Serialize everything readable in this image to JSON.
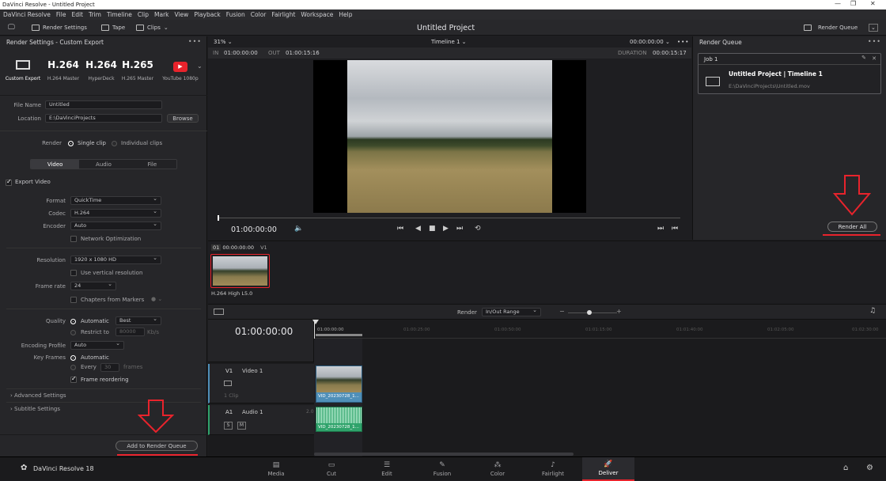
{
  "window": {
    "title": "DaVinci Resolve - Untitled Project"
  },
  "menu": [
    "DaVinci Resolve",
    "File",
    "Edit",
    "Trim",
    "Timeline",
    "Clip",
    "Mark",
    "View",
    "Playback",
    "Fusion",
    "Color",
    "Fairlight",
    "Workspace",
    "Help"
  ],
  "toolbar": {
    "render_settings": "Render Settings",
    "tape": "Tape",
    "clips": "Clips",
    "project_title": "Untitled Project",
    "render_queue": "Render Queue"
  },
  "render_settings": {
    "header": "Render Settings - Custom Export",
    "presets": [
      {
        "big": "",
        "label": "Custom Export"
      },
      {
        "big": "H.264",
        "label": "H.264 Master"
      },
      {
        "big": "H.264",
        "label": "HyperDeck"
      },
      {
        "big": "H.265",
        "label": "H.265 Master"
      },
      {
        "big": "",
        "label": "YouTube 1080p"
      }
    ],
    "file_name_label": "File Name",
    "file_name": "Untitled",
    "location_label": "Location",
    "location": "E:\\DaVinciProjects",
    "browse": "Browse",
    "render_label": "Render",
    "single_clip": "Single clip",
    "individual_clips": "Individual clips",
    "tabs": [
      "Video",
      "Audio",
      "File"
    ],
    "export_video": "Export Video",
    "format_label": "Format",
    "format": "QuickTime",
    "codec_label": "Codec",
    "codec": "H.264",
    "encoder_label": "Encoder",
    "encoder": "Auto",
    "network_opt": "Network Optimization",
    "resolution_label": "Resolution",
    "resolution": "1920 x 1080 HD",
    "vertical_res": "Use vertical resolution",
    "framerate_label": "Frame rate",
    "framerate": "24",
    "chapters": "Chapters from Markers",
    "quality_label": "Quality",
    "automatic": "Automatic",
    "best": "Best",
    "restrict_to": "Restrict to",
    "restrict_value": "80000",
    "kbs": "Kb/s",
    "encoding_profile_label": "Encoding Profile",
    "encoding_profile": "Auto",
    "keyframes_label": "Key Frames",
    "kf_automatic": "Automatic",
    "every": "Every",
    "every_value": "30",
    "frames": "frames",
    "frame_reordering": "Frame reordering",
    "advanced": "Advanced Settings",
    "subtitle": "Subtitle Settings",
    "add_to_queue": "Add to Render Queue"
  },
  "viewer": {
    "zoom": "31%",
    "timeline_name": "Timeline 1",
    "timecode_top": "00:00:00:00",
    "in_label": "IN",
    "in_tc": "01:00:00:00",
    "out_label": "OUT",
    "out_tc": "01:00:15:16",
    "duration_label": "DURATION",
    "duration_tc": "00:00:15:17",
    "current_tc": "01:00:00:00"
  },
  "render_queue": {
    "header": "Render Queue",
    "job_label": "Job 1",
    "job_title": "Untitled Project | Timeline 1",
    "job_path": "E:\\DaVinciProjects\\Untitled.mov",
    "render_all": "Render All"
  },
  "clip_strip": {
    "index": "01",
    "tc": "00:00:00:00",
    "track": "V1",
    "clip_label": "H.264 High L5.0"
  },
  "timeline_bar": {
    "render_label": "Render",
    "range": "In/Out Range"
  },
  "timeline": {
    "timecode": "01:00:00:00",
    "ruler": [
      "01:00:00:00",
      "01:00:25:00",
      "01:00:50:00",
      "01:01:15:00",
      "01:01:40:00",
      "01:02:05:00",
      "01:02:30:00"
    ],
    "v1_label": "V1",
    "v1_name": "Video 1",
    "v1_clips": "1 Clip",
    "a1_label": "A1",
    "a1_name": "Audio 1",
    "a1_ch": "2.0",
    "video_clip": "VID_20230728_1...",
    "audio_clip": "VID_20230728_1...",
    "solo": "S",
    "mute": "M"
  },
  "bottom": {
    "app_name": "DaVinci Resolve 18",
    "pages": [
      {
        "name": "Media",
        "icon": "media-icon"
      },
      {
        "name": "Cut",
        "icon": "cut-icon"
      },
      {
        "name": "Edit",
        "icon": "edit-icon"
      },
      {
        "name": "Fusion",
        "icon": "fusion-icon"
      },
      {
        "name": "Color",
        "icon": "color-icon"
      },
      {
        "name": "Fairlight",
        "icon": "fairlight-icon"
      },
      {
        "name": "Deliver",
        "icon": "deliver-icon"
      }
    ],
    "active_page": "Deliver"
  },
  "colors": {
    "accent_red": "#e8232c",
    "panel": "#262629",
    "video_clip": "#4f8fb8",
    "audio_clip": "#2fa36b"
  }
}
